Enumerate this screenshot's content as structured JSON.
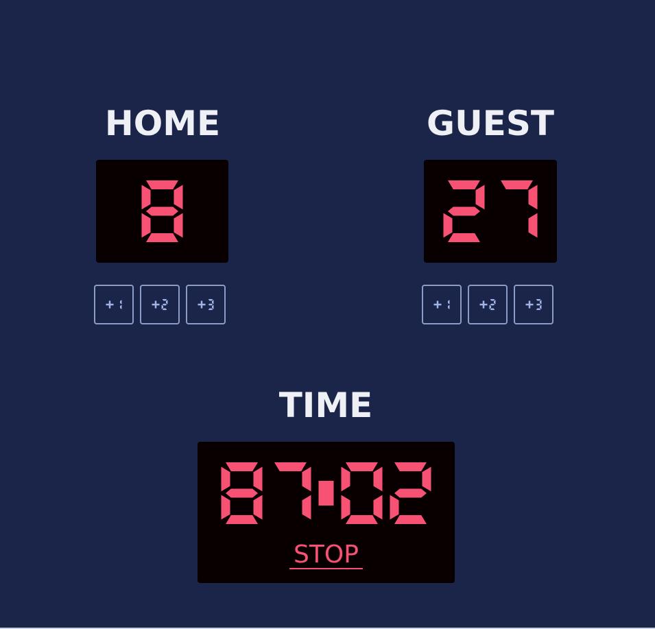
{
  "home": {
    "title": "HOME",
    "score": "8",
    "buttons": [
      "+1",
      "+2",
      "+3"
    ]
  },
  "guest": {
    "title": "GUEST",
    "score": "27",
    "buttons": [
      "+1",
      "+2",
      "+3"
    ]
  },
  "timer": {
    "title": "TIME",
    "value": "87:02",
    "stop_label": "STOP"
  },
  "colors": {
    "background": "#1b2449",
    "panel": "#080000",
    "digit": "#f75274",
    "button_border": "#8c9cc8",
    "button_text": "#9fb3e6",
    "title": "#eef0f6"
  }
}
